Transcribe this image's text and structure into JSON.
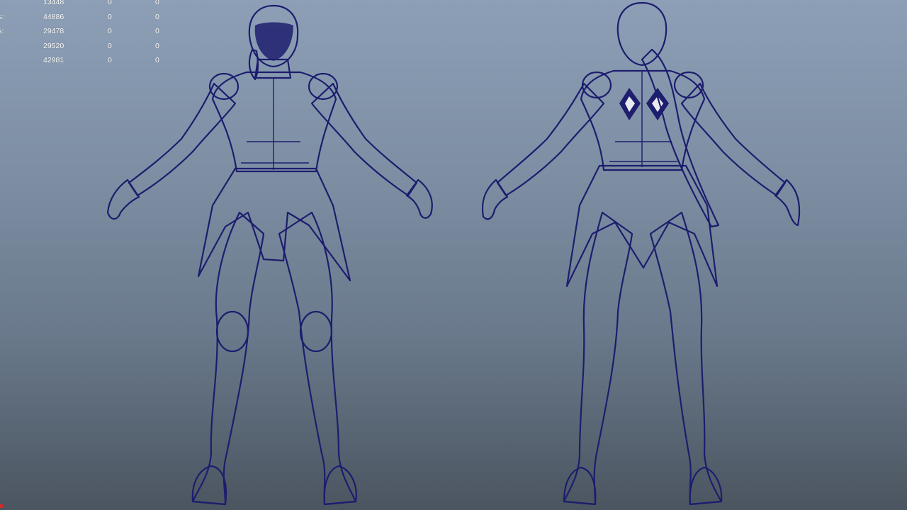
{
  "viewport": {
    "background_top": "#8c9fb6",
    "background_bottom": "#4b5560",
    "wire_color": "#1d1d6e",
    "surface_color": "#e9eaf0"
  },
  "hud": {
    "rows": [
      {
        "label": "",
        "v1": "13448",
        "v2": "0",
        "v3": "0"
      },
      {
        "label": "s:",
        "v1": "44886",
        "v2": "0",
        "v3": "0"
      },
      {
        "label": "s:",
        "v1": "29478",
        "v2": "0",
        "v3": "0"
      },
      {
        "label": "",
        "v1": "29520",
        "v2": "0",
        "v3": "0"
      },
      {
        "label": "",
        "v1": "42981",
        "v2": "0",
        "v3": "0"
      }
    ]
  },
  "models": {
    "front_view": "character-front-wireframe",
    "back_view": "character-back-wireframe"
  }
}
